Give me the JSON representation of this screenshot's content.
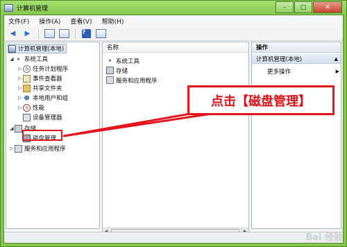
{
  "window": {
    "title": "计算机管理",
    "controls": {
      "minimize": "–",
      "maximize": "□",
      "close": "✕"
    }
  },
  "menu": [
    "文件(F)",
    "操作(A)",
    "查看(V)",
    "帮助(H)"
  ],
  "tree": {
    "root": "计算机管理(本地)",
    "system_tools": "系统工具",
    "task_scheduler": "任务计划程序",
    "event_viewer": "事件查看器",
    "shared_folders": "共享文件夹",
    "local_users": "本地用户和组",
    "performance": "性能",
    "device_manager": "设备管理器",
    "storage": "存储",
    "disk_management": "磁盘管理",
    "services_apps": "服务和应用程序"
  },
  "list": {
    "column_name": "名称",
    "items": [
      "系统工具",
      "存储",
      "服务和应用程序"
    ]
  },
  "actions": {
    "title": "操作",
    "section": "计算机管理(本地)",
    "more": "更多操作"
  },
  "annotation": {
    "callout_text": "点击【磁盘管理】"
  },
  "watermark": {
    "text": "Bai 经验"
  },
  "colors": {
    "frame_green": "#86c84e",
    "annotation_red": "#e4141d"
  }
}
